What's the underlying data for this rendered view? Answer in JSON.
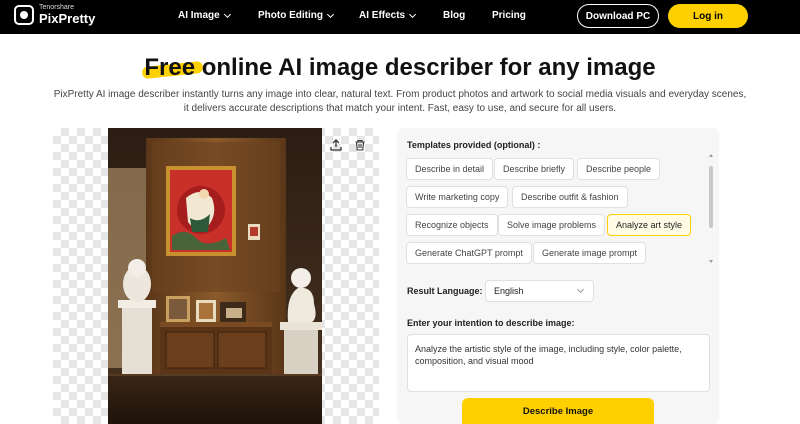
{
  "nav": {
    "logo_sub": "Tenorshare",
    "logo_main": "PixPretty",
    "items": [
      {
        "label": "AI Image"
      },
      {
        "label": "Photo Editing"
      },
      {
        "label": "AI Effects"
      },
      {
        "label": "Blog"
      },
      {
        "label": "Pricing"
      }
    ],
    "download_label": "Download PC",
    "login_label": "Log in"
  },
  "hero": {
    "title_highlight": "Free",
    "title_rest": " online AI image describer for any image",
    "description": "PixPretty AI image describer instantly turns any image into clear, natural text. From product photos and artwork to social media visuals and everyday scenes, it delivers accurate descriptions that match your intent. Fast, easy to use, and secure for all users."
  },
  "image_panel": {
    "icons": [
      "upload-icon",
      "trash-icon"
    ]
  },
  "form": {
    "templates_label": "Templates provided (optional) :",
    "templates": [
      "Describe in detail",
      "Describe briefly",
      "Describe people",
      "Write marketing copy",
      "Describe outfit & fashion",
      "Recognize objects",
      "Solve image problems",
      "Analyze art style",
      "Generate ChatGPT prompt",
      "Generate image prompt"
    ],
    "selected_template": "Analyze art style",
    "language_label": "Result Language:",
    "language_value": "English",
    "intention_label": "Enter your intention to describe image:",
    "intention_value": "Analyze the artistic style of the image, including style, color palette, composition, and visual mood",
    "describe_button": "Describe Image"
  },
  "colors": {
    "accent": "#ffd000",
    "nav_bg": "#000000"
  }
}
